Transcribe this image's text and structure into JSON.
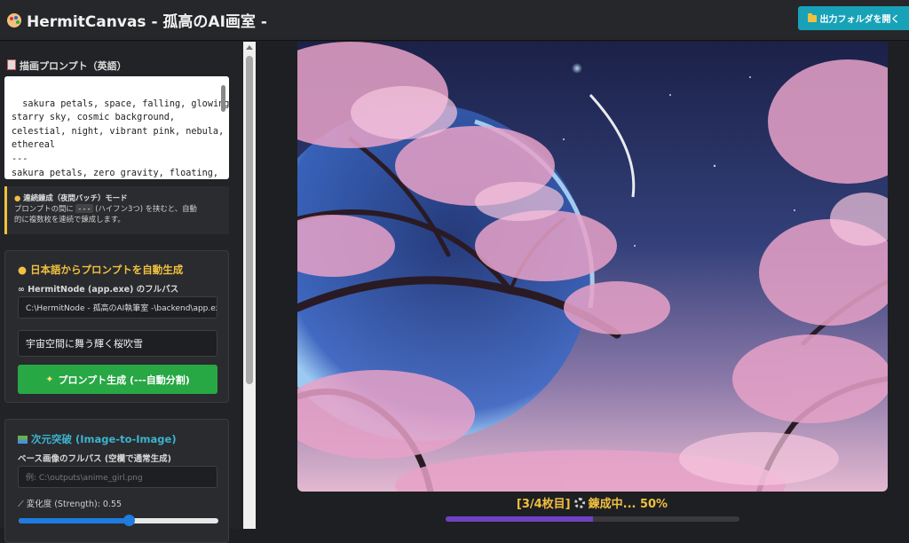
{
  "header": {
    "title": "HermitCanvas - 孤高のAI画室 -",
    "open_folder_label": "出力フォルダを開く"
  },
  "prompt_section": {
    "label": "描画プロンプト（英語）",
    "text": "sakura petals, space, falling, glowing,\nstarry sky, cosmic background,\ncelestial, night, vibrant pink, nebula,\nethereal\n---\nsakura petals, zero gravity, floating,\ndeep space, distant galaxy, astronomical"
  },
  "info_box": {
    "title": "連続錬成（夜間バッチ）モード",
    "line_prefix": "プロンプトの間に",
    "code": "---",
    "line_suffix": "(ハイフン3つ) を挟むと、自動",
    "line2": "的に複数枚を連続で錬成します。"
  },
  "auto_prompt": {
    "title": "日本語からプロンプトを自動生成",
    "path_label": "HermitNode (app.exe) のフルパス",
    "path_value": "C:\\HermitNode - 孤高のAI執筆室 -\\backend\\app.exe",
    "jp_input_value": "宇宙空間に舞う輝く桜吹雪",
    "generate_label": "プロンプト生成 (---自動分割)"
  },
  "img2img": {
    "title": "次元突破 (Image-to-Image)",
    "base_label": "ベース画像のフルパス (空欄で通常生成)",
    "base_placeholder": "例: C:\\outputs\\anime_girl.png",
    "strength_label": "変化度 (Strength): 0.55",
    "strength": 0.55
  },
  "status": {
    "text": "[3/4枚目] ⚙ 錬成中... 50%",
    "prefix": "[3/4枚目]",
    "suffix": "錬成中... 50%",
    "progress_percent": 50
  },
  "colors": {
    "accent_yellow": "#f0c040",
    "accent_teal": "#17a2b8",
    "button_green": "#28a745",
    "slider_blue": "#1e7be0",
    "progress_purple": "#6f42c1"
  }
}
